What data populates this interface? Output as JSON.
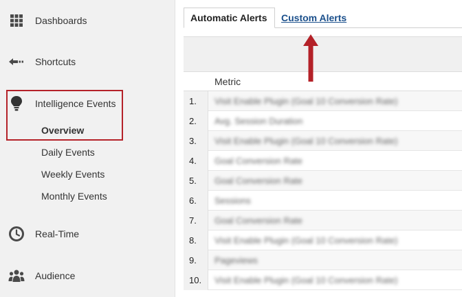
{
  "sidebar": {
    "items": [
      {
        "label": "Dashboards",
        "icon": "grid-icon"
      },
      {
        "label": "Shortcuts",
        "icon": "arrow-left-icon"
      },
      {
        "label": "Intelligence Events",
        "icon": "lightbulb-icon"
      },
      {
        "label": "Real-Time",
        "icon": "clock-icon"
      },
      {
        "label": "Audience",
        "icon": "people-icon"
      }
    ],
    "subitems": [
      {
        "label": "Overview",
        "active": true
      },
      {
        "label": "Daily Events"
      },
      {
        "label": "Weekly Events"
      },
      {
        "label": "Monthly Events"
      }
    ]
  },
  "tabs": {
    "automatic": "Automatic Alerts",
    "custom": "Custom Alerts"
  },
  "table": {
    "header_metric": "Metric",
    "rows": [
      {
        "num": "1.",
        "metric": "Visit Enable Plugin (Goal 10 Conversion Rate)"
      },
      {
        "num": "2.",
        "metric": "Avg. Session Duration"
      },
      {
        "num": "3.",
        "metric": "Visit Enable Plugin (Goal 10 Conversion Rate)"
      },
      {
        "num": "4.",
        "metric": "Goal Conversion Rate"
      },
      {
        "num": "5.",
        "metric": "Goal Conversion Rate"
      },
      {
        "num": "6.",
        "metric": "Sessions"
      },
      {
        "num": "7.",
        "metric": "Goal Conversion Rate"
      },
      {
        "num": "8.",
        "metric": "Visit Enable Plugin (Goal 10 Conversion Rate)"
      },
      {
        "num": "9.",
        "metric": "Pageviews"
      },
      {
        "num": "10.",
        "metric": "Visit Enable Plugin (Goal 10 Conversion Rate)"
      }
    ]
  },
  "colors": {
    "highlight": "#b42128",
    "link": "#1a4f8b"
  }
}
